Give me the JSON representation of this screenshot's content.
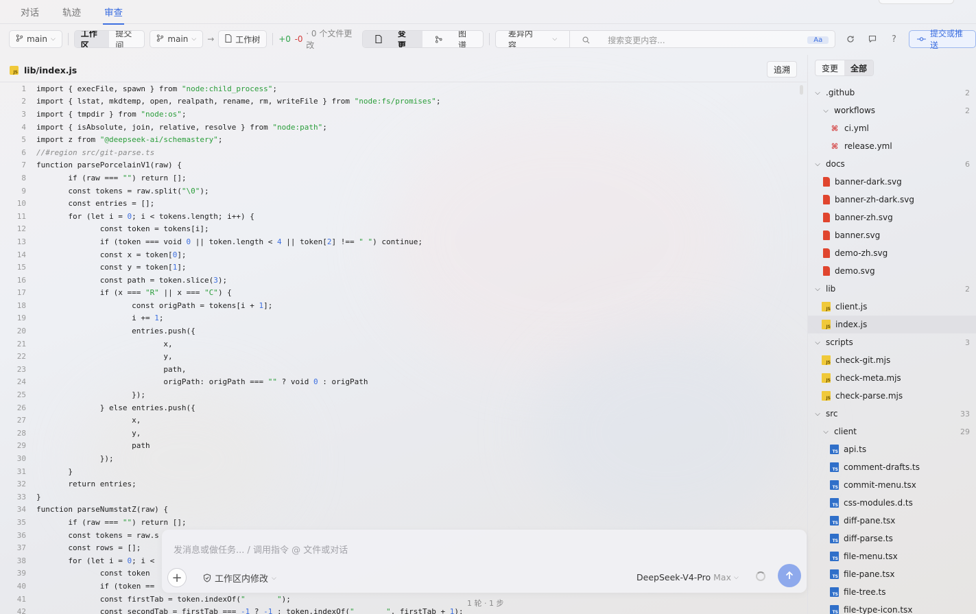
{
  "top_tabs": [
    {
      "label": "对话",
      "active": false
    },
    {
      "label": "轨迹",
      "active": false
    },
    {
      "label": "审查",
      "active": true
    }
  ],
  "toolbar": {
    "branch_left": "main",
    "seg_workspace": "工作区",
    "seg_commit": "提交间",
    "branch_right": "main",
    "arrow": "→",
    "worktree": "工作树",
    "added": "+0",
    "removed": "-0",
    "files_changed": "· 0 个文件更改",
    "view_changes": "变更",
    "view_graph": "图谱",
    "diff_content": "差异内容",
    "search_placeholder": "搜索变更内容...",
    "search_aa": "Aa",
    "commit_push": "提交或推送"
  },
  "file_header": {
    "path": "lib/index.js",
    "trace_label": "追溯"
  },
  "code_lines": [
    [
      "import { execFile, spawn } from ",
      {
        "s": "\"node:child_process\""
      },
      ";"
    ],
    [
      "import { lstat, mkdtemp, open, realpath, rename, rm, writeFile } from ",
      {
        "s": "\"node:fs/promises\""
      },
      ";"
    ],
    [
      "import { tmpdir } from ",
      {
        "s": "\"node:os\""
      },
      ";"
    ],
    [
      "import { isAbsolute, join, relative, resolve } from ",
      {
        "s": "\"node:path\""
      },
      ";"
    ],
    [
      "import z from ",
      {
        "s": "\"@deepseek-ai/schemastery\""
      },
      ";"
    ],
    [
      {
        "c": "//#region src/git-parse.ts"
      }
    ],
    [
      "function parsePorcelainV1(raw) {"
    ],
    [
      "\tif (raw === ",
      {
        "s": "\"\""
      },
      ") return [];"
    ],
    [
      "\tconst tokens = raw.split(",
      {
        "s": "\"\\0\""
      },
      ");"
    ],
    [
      "\tconst entries = [];"
    ],
    [
      "\tfor (let i = ",
      {
        "n": "0"
      },
      "; i < tokens.length; i++) {"
    ],
    [
      "\t\tconst token = tokens[i];"
    ],
    [
      "\t\tif (token === void ",
      {
        "n": "0"
      },
      " || token.length < ",
      {
        "n": "4"
      },
      " || token[",
      {
        "n": "2"
      },
      "] !== ",
      {
        "s": "\" \""
      },
      ") continue;"
    ],
    [
      "\t\tconst x = token[",
      {
        "n": "0"
      },
      "];"
    ],
    [
      "\t\tconst y = token[",
      {
        "n": "1"
      },
      "];"
    ],
    [
      "\t\tconst path = token.slice(",
      {
        "n": "3"
      },
      ");"
    ],
    [
      "\t\tif (x === ",
      {
        "s": "\"R\""
      },
      " || x === ",
      {
        "s": "\"C\""
      },
      ") {"
    ],
    [
      "\t\t\tconst origPath = tokens[i + ",
      {
        "n": "1"
      },
      "];"
    ],
    [
      "\t\t\ti += ",
      {
        "n": "1"
      },
      ";"
    ],
    [
      "\t\t\tentries.push({"
    ],
    [
      "\t\t\t\tx,"
    ],
    [
      "\t\t\t\ty,"
    ],
    [
      "\t\t\t\tpath,"
    ],
    [
      "\t\t\t\torigPath: origPath === ",
      {
        "s": "\"\""
      },
      " ? void ",
      {
        "n": "0"
      },
      " : origPath"
    ],
    [
      "\t\t\t});"
    ],
    [
      "\t\t} else entries.push({"
    ],
    [
      "\t\t\tx,"
    ],
    [
      "\t\t\ty,"
    ],
    [
      "\t\t\tpath"
    ],
    [
      "\t\t});"
    ],
    [
      "\t}"
    ],
    [
      "\treturn entries;"
    ],
    [
      "}"
    ],
    [
      "function parseNumstatZ(raw) {"
    ],
    [
      "\tif (raw === ",
      {
        "s": "\"\""
      },
      ") return [];"
    ],
    [
      "\tconst tokens = raw.s"
    ],
    [
      "\tconst rows = [];"
    ],
    [
      "\tfor (let i = ",
      {
        "n": "0"
      },
      "; i <"
    ],
    [
      "\t\tconst token"
    ],
    [
      "\t\tif (token =="
    ],
    [
      "\t\tconst firstTab = token.indexOf(",
      {
        "s": "\"\t\""
      },
      ");"
    ],
    [
      "\t\tconst secondTab = firstTab === ",
      {
        "n": "-1"
      },
      " ? ",
      {
        "n": "-1"
      },
      " : token.indexOf(",
      {
        "s": "\"\t\""
      },
      ", firstTab + ",
      {
        "n": "1"
      },
      ");"
    ]
  ],
  "tree": {
    "seg_changes": "变更",
    "seg_all": "全部",
    "nodes": [
      {
        "depth": 0,
        "type": "dir",
        "name": ".github",
        "count": "2"
      },
      {
        "depth": 1,
        "type": "dir",
        "name": "workflows",
        "count": "2"
      },
      {
        "depth": 2,
        "type": "yml",
        "name": "ci.yml"
      },
      {
        "depth": 2,
        "type": "yml",
        "name": "release.yml"
      },
      {
        "depth": 0,
        "type": "dir",
        "name": "docs",
        "count": "6"
      },
      {
        "depth": 1,
        "type": "svg",
        "name": "banner-dark.svg"
      },
      {
        "depth": 1,
        "type": "svg",
        "name": "banner-zh-dark.svg"
      },
      {
        "depth": 1,
        "type": "svg",
        "name": "banner-zh.svg"
      },
      {
        "depth": 1,
        "type": "svg",
        "name": "banner.svg"
      },
      {
        "depth": 1,
        "type": "svg",
        "name": "demo-zh.svg"
      },
      {
        "depth": 1,
        "type": "svg",
        "name": "demo.svg"
      },
      {
        "depth": 0,
        "type": "dir",
        "name": "lib",
        "count": "2"
      },
      {
        "depth": 1,
        "type": "js",
        "name": "client.js"
      },
      {
        "depth": 1,
        "type": "js",
        "name": "index.js",
        "selected": true
      },
      {
        "depth": 0,
        "type": "dir",
        "name": "scripts",
        "count": "3"
      },
      {
        "depth": 1,
        "type": "js",
        "name": "check-git.mjs"
      },
      {
        "depth": 1,
        "type": "js",
        "name": "check-meta.mjs"
      },
      {
        "depth": 1,
        "type": "js",
        "name": "check-parse.mjs"
      },
      {
        "depth": 0,
        "type": "dir",
        "name": "src",
        "count": "33"
      },
      {
        "depth": 1,
        "type": "dir",
        "name": "client",
        "count": "29"
      },
      {
        "depth": 2,
        "type": "ts",
        "name": "api.ts"
      },
      {
        "depth": 2,
        "type": "ts",
        "name": "comment-drafts.ts"
      },
      {
        "depth": 2,
        "type": "ts",
        "name": "commit-menu.tsx"
      },
      {
        "depth": 2,
        "type": "ts",
        "name": "css-modules.d.ts"
      },
      {
        "depth": 2,
        "type": "ts",
        "name": "diff-pane.tsx"
      },
      {
        "depth": 2,
        "type": "ts",
        "name": "diff-parse.ts"
      },
      {
        "depth": 2,
        "type": "ts",
        "name": "file-menu.tsx"
      },
      {
        "depth": 2,
        "type": "ts",
        "name": "file-pane.tsx"
      },
      {
        "depth": 2,
        "type": "ts",
        "name": "file-tree.ts"
      },
      {
        "depth": 2,
        "type": "ts",
        "name": "file-type-icon.tsx"
      }
    ]
  },
  "composer": {
    "placeholder": "发消息或做任务... / 调用指令 @ 文件或对话",
    "mode": "工作区内修改",
    "model": "DeepSeek-V4-Pro",
    "model_tier": "Max",
    "steps": "1 轮 · 1 步"
  },
  "icons": {
    "branch": "branch-icon",
    "worktree": "file-icon",
    "changes": "file-icon",
    "graph": "graph-icon",
    "search": "search-icon",
    "refresh": "refresh-icon",
    "comment": "comment-icon",
    "help": "question-icon",
    "commit": "commit-icon",
    "send": "arrow-up-icon",
    "add": "plus-icon"
  },
  "colors": {
    "accent": "#3d6fe0",
    "added": "#2fa34a",
    "removed": "#d23b3b",
    "string": "#2a9d3a",
    "number": "#3d6fe0"
  }
}
